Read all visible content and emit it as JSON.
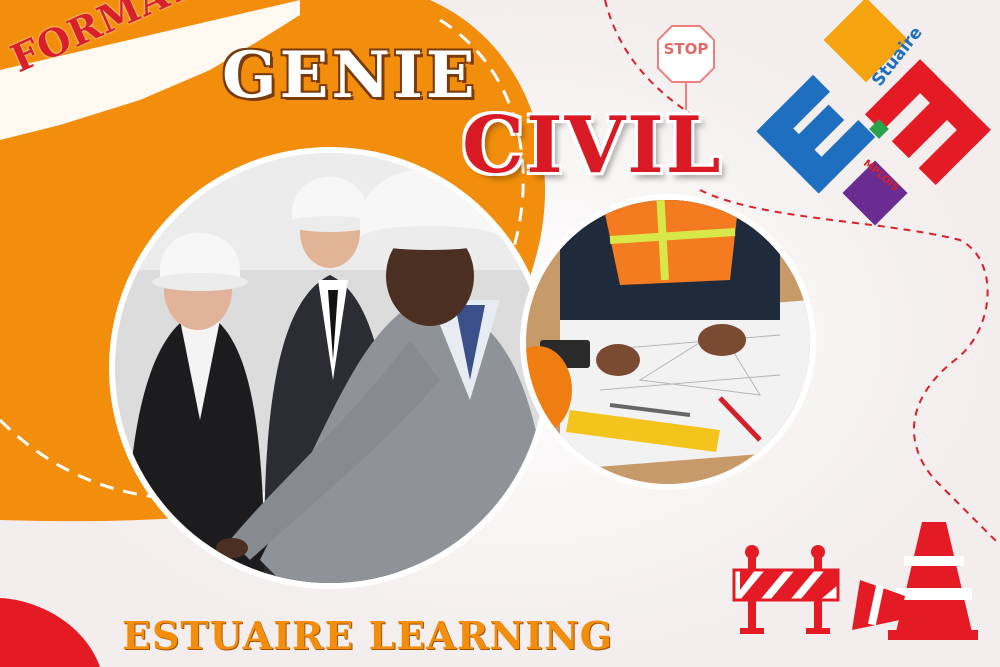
{
  "banner": {
    "kicker": "FORMATION",
    "title_line1": "GENIE",
    "title_line2": "CIVIL",
    "brand": "ESTUAIRE LEARNING"
  },
  "sign": {
    "stop_text": "STOP"
  },
  "logo": {
    "line1": "Stuaire",
    "line2": "MPLOIS"
  },
  "colors": {
    "orange": "#f28e0b",
    "red": "#d91a25",
    "logo_blue": "#1f6fc0",
    "logo_orange": "#f5a30f",
    "logo_green": "#2aa24a",
    "logo_purple": "#6a2c91"
  },
  "icons": [
    "stop-sign-icon",
    "road-barrier-icon",
    "traffic-cone-icon",
    "estuaire-emplois-logo"
  ]
}
